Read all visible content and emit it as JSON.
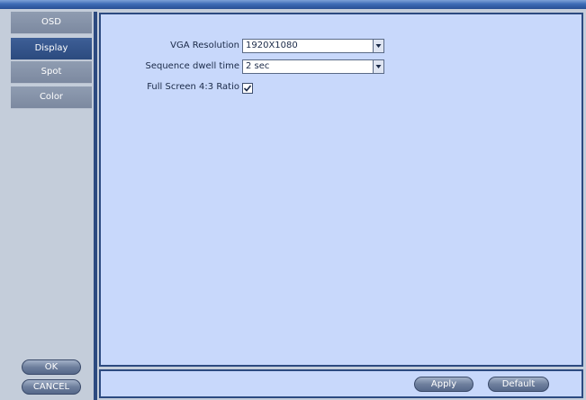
{
  "sidebar": {
    "items": [
      {
        "label": "OSD"
      },
      {
        "label": "Display"
      },
      {
        "label": "Spot"
      },
      {
        "label": "Color"
      }
    ],
    "ok_label": "OK",
    "cancel_label": "CANCEL"
  },
  "display": {
    "vga_resolution": {
      "label": "VGA Resolution",
      "value": "1920X1080"
    },
    "sequence_dwell": {
      "label": "Sequence dwell time",
      "value": "2 sec"
    },
    "full_screen_ratio": {
      "label": "Full Screen 4:3 Ratio",
      "checked": true
    }
  },
  "footer": {
    "apply_label": "Apply",
    "default_label": "Default"
  },
  "colors": {
    "active_tab": "#2b4a7e",
    "content_bg": "#c8d8fb",
    "frame": "#2c4a80"
  }
}
